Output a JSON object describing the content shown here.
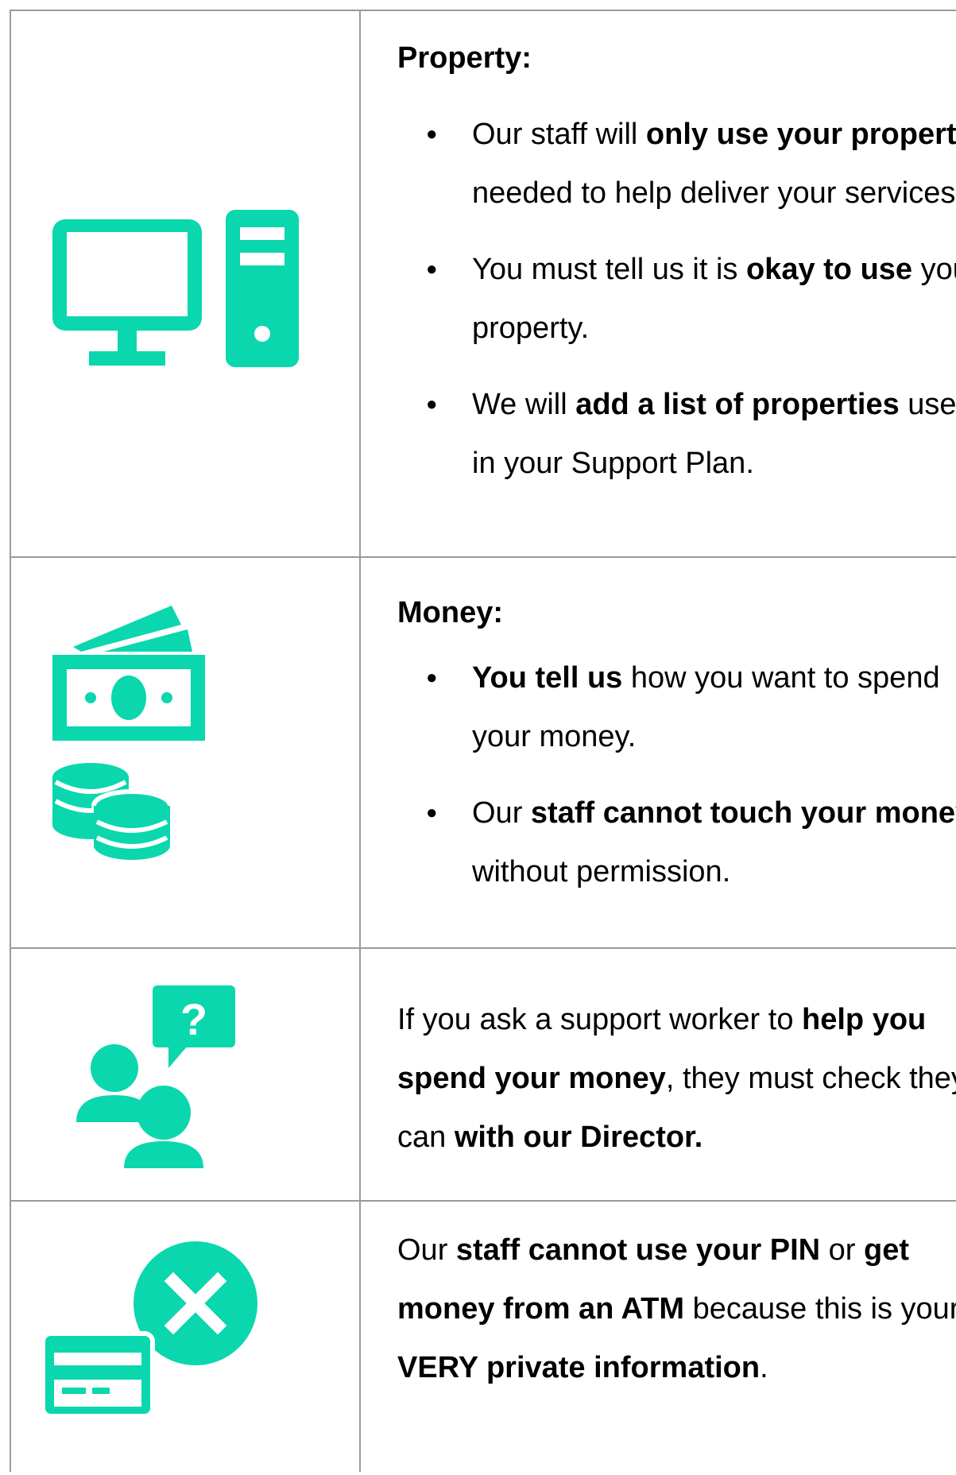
{
  "colors": {
    "icon_teal": "#0ad7ad",
    "border": "#9a9a9a"
  },
  "rows": [
    {
      "icons": [
        "computer-icon"
      ],
      "heading": "Property:",
      "bullets": [
        {
          "pre": "Our staff will ",
          "bold": "only use your property",
          "post": " if needed to help deliver your services."
        },
        {
          "pre": "You must tell us it is ",
          "bold": "okay to use",
          "post": " your property."
        },
        {
          "pre": "We will ",
          "bold": "add a list of properties",
          "post": " used in your Support Plan."
        }
      ]
    },
    {
      "icons": [
        "banknotes-icon",
        "coins-icon"
      ],
      "heading": "Money:",
      "bullets": [
        {
          "pre": "",
          "bold": "You tell us",
          "post": " how you want to spend your money."
        },
        {
          "pre": "Our ",
          "bold": "staff cannot touch your money",
          "post": " without permission."
        }
      ]
    },
    {
      "icons": [
        "people-question-icon"
      ],
      "text": {
        "p1": "If you ask a support worker to ",
        "b1": "help you spend your money",
        "p2": ", they must check they can ",
        "b2": "with our Director."
      }
    },
    {
      "icons": [
        "card-cancel-icon"
      ],
      "text": {
        "p1": "Our ",
        "b1": "staff cannot use your PIN",
        "p2": " or ",
        "b2": "get money from an ATM",
        "p3": " because this is your ",
        "b3": "VERY private information",
        "p4": "."
      }
    }
  ]
}
